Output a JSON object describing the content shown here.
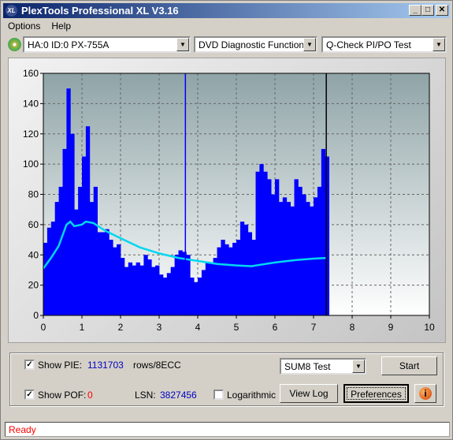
{
  "window": {
    "title": "PlexTools Professional XL V3.16",
    "logo": "XL"
  },
  "menu": [
    "Options",
    "Help"
  ],
  "toolbar": {
    "drive": "HA:0 ID:0  PX-755A",
    "function": "DVD Diagnostic Functions",
    "test": "Q-Check PI/PO Test"
  },
  "controls": {
    "show_pie_label": "Show PIE:",
    "pie_value": "1131703",
    "pie_unit": "rows/8ECC",
    "show_pof_label": "Show POF:",
    "pof_value": "0",
    "lsn_label": "LSN:",
    "lsn_value": "3827456",
    "logarithmic_label": "Logarithmic",
    "show_pie_checked": true,
    "show_pof_checked": true,
    "logarithmic_checked": false,
    "test_mode": "SUM8 Test",
    "start": "Start",
    "view_log": "View Log",
    "preferences": "Preferences"
  },
  "status": "Ready",
  "colors": {
    "pie_bars": "#0000ff",
    "pif_line": "#00d8f0",
    "marker": "#0000ff",
    "end_marker": "#000000",
    "status_text": "#ff0000"
  },
  "chart_data": {
    "type": "bar",
    "xlim": [
      0,
      10
    ],
    "ylim": [
      0,
      160
    ],
    "xticks": [
      0,
      1,
      2,
      3,
      4,
      5,
      6,
      7,
      8,
      9,
      10
    ],
    "yticks": [
      0,
      20,
      40,
      60,
      80,
      100,
      120,
      140,
      160
    ],
    "grid": true,
    "series": [
      {
        "kind": "bar",
        "x": [
          0,
          0.1,
          0.2,
          0.3,
          0.4,
          0.5,
          0.6,
          0.7,
          0.8,
          0.9,
          1.0,
          1.1,
          1.2,
          1.3,
          1.4,
          1.5,
          1.6,
          1.7,
          1.8,
          1.9,
          2.0,
          2.1,
          2.2,
          2.3,
          2.4,
          2.5,
          2.6,
          2.7,
          2.8,
          2.9,
          3.0,
          3.1,
          3.2,
          3.3,
          3.4,
          3.5,
          3.6,
          3.7,
          3.8,
          3.9,
          4.0,
          4.1,
          4.2,
          4.3,
          4.4,
          4.5,
          4.6,
          4.7,
          4.8,
          4.9,
          5.0,
          5.1,
          5.2,
          5.3,
          5.4,
          5.5,
          5.6,
          5.7,
          5.8,
          5.9,
          6.0,
          6.1,
          6.2,
          6.3,
          6.4,
          6.5,
          6.6,
          6.7,
          6.8,
          6.9,
          7.0,
          7.1,
          7.2,
          7.3
        ],
        "values": [
          48,
          58,
          62,
          75,
          85,
          110,
          150,
          120,
          70,
          85,
          105,
          125,
          75,
          85,
          55,
          55,
          57,
          50,
          45,
          47,
          38,
          32,
          35,
          33,
          35,
          33,
          40,
          37,
          32,
          33,
          27,
          25,
          28,
          32,
          40,
          43,
          42,
          40,
          25,
          22,
          25,
          30,
          35,
          35,
          38,
          45,
          50,
          47,
          45,
          48,
          50,
          62,
          60,
          55,
          50,
          95,
          100,
          95,
          90,
          80,
          90,
          75,
          78,
          75,
          72,
          90,
          85,
          80,
          75,
          72,
          78,
          85,
          110,
          105
        ]
      },
      {
        "kind": "line",
        "x": [
          0,
          0.2,
          0.4,
          0.6,
          0.7,
          0.8,
          1.0,
          1.1,
          1.3,
          1.6,
          2.0,
          2.5,
          3.0,
          3.5,
          4.0,
          4.5,
          5.0,
          5.4,
          5.5,
          6.0,
          6.5,
          7.0,
          7.33
        ],
        "values": [
          31,
          38,
          46,
          60,
          62,
          59,
          60,
          62,
          61,
          56,
          51,
          45,
          41,
          38,
          36,
          34,
          33,
          32.5,
          33,
          35,
          36.5,
          37.5,
          38
        ]
      }
    ],
    "markers": [
      {
        "x": 3.68,
        "value": 160
      },
      {
        "x": 7.33
      }
    ]
  }
}
